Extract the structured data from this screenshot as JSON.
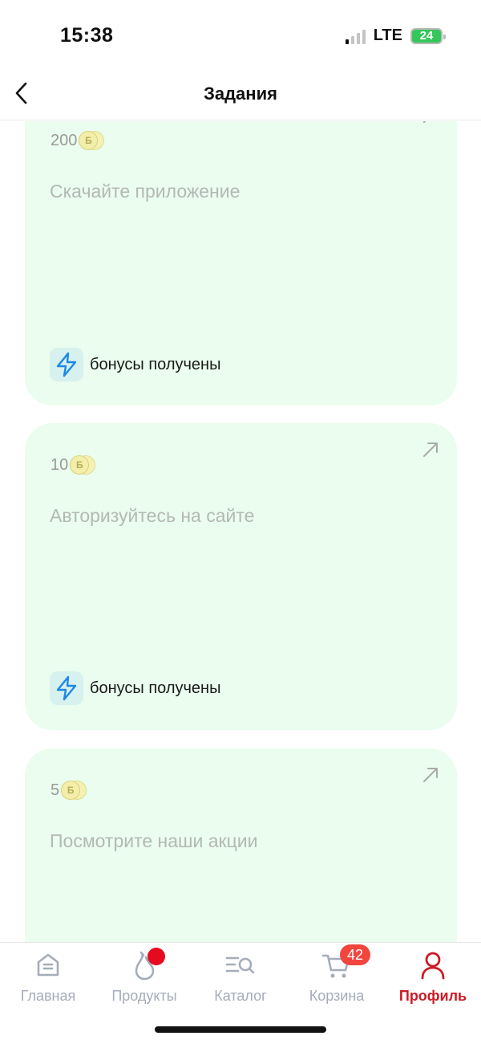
{
  "status_bar": {
    "time": "15:38",
    "network": "LTE",
    "battery": "24"
  },
  "nav": {
    "title": "Задания",
    "back_icon": "chevron-left-icon"
  },
  "tasks": [
    {
      "points": "200",
      "coin_letter": "Б",
      "title": "Скачайте приложение",
      "status": "бонусы получены"
    },
    {
      "points": "10",
      "coin_letter": "Б",
      "title": "Авторизуйтесь на сайте",
      "status": "бонусы получены"
    },
    {
      "points": "5",
      "coin_letter": "Б",
      "title": "Посмотрите наши акции"
    }
  ],
  "tabs": [
    {
      "label": "Главная",
      "icon": "home-icon"
    },
    {
      "label": "Продукты",
      "icon": "pear-icon"
    },
    {
      "label": "Каталог",
      "icon": "catalog-search-icon"
    },
    {
      "label": "Корзина",
      "icon": "cart-icon",
      "badge": "42"
    },
    {
      "label": "Профиль",
      "icon": "profile-icon",
      "active": true
    }
  ],
  "colors": {
    "card_bg": "#eafdee",
    "accent_active": "#cc1a26",
    "badge_red": "#f2453d",
    "bolt_blue": "#1e88e5",
    "tab_inactive": "#a5acba"
  }
}
